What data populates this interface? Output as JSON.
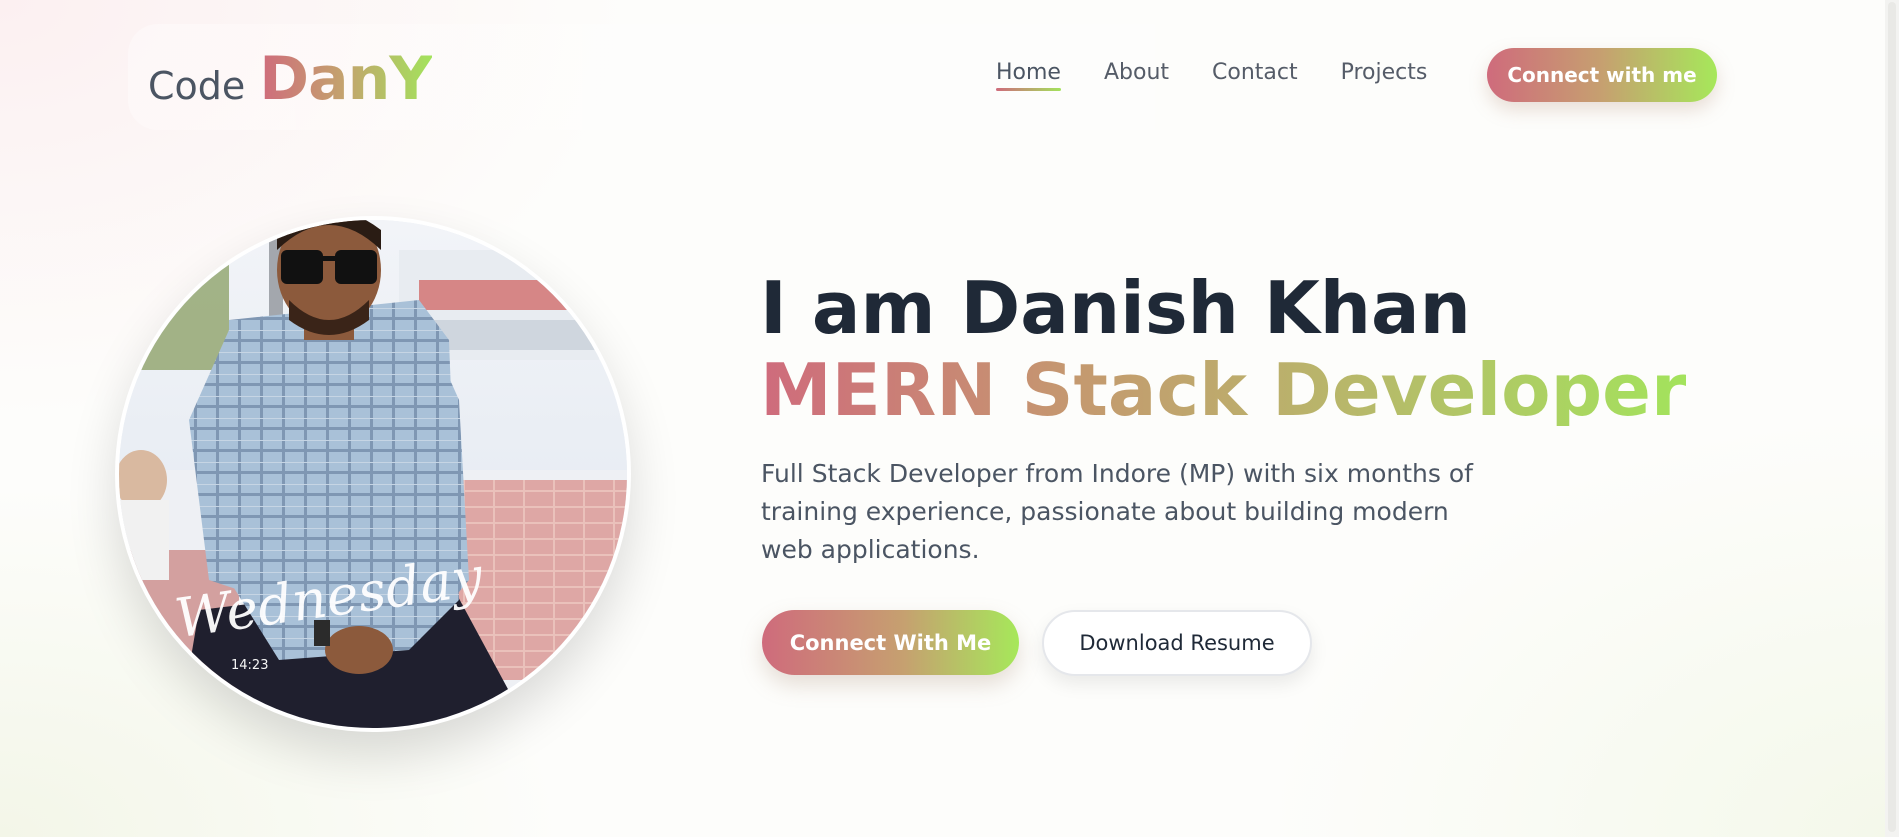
{
  "brand": {
    "prefix": "Code",
    "name": "DanY"
  },
  "nav": {
    "links": [
      {
        "label": "Home",
        "active": true
      },
      {
        "label": "About",
        "active": false
      },
      {
        "label": "Contact",
        "active": false
      },
      {
        "label": "Projects",
        "active": false
      }
    ],
    "cta_label": "Connect with me"
  },
  "profile": {
    "photo_overlay_text": "Wednesday",
    "photo_overlay_time": "14:23"
  },
  "hero": {
    "greeting": "I am Danish Khan",
    "role": "MERN Stack Developer",
    "description": "Full Stack Developer from Indore (MP) with six months of training experience, passionate about building modern web applications.",
    "primary_button": "Connect With Me",
    "secondary_button": "Download Resume"
  },
  "colors": {
    "gradient_start": "#cf6b7c",
    "gradient_mid": "#c3a46d",
    "gradient_end": "#a3e35c",
    "heading": "#1f2937",
    "body_text": "#4b5563"
  }
}
